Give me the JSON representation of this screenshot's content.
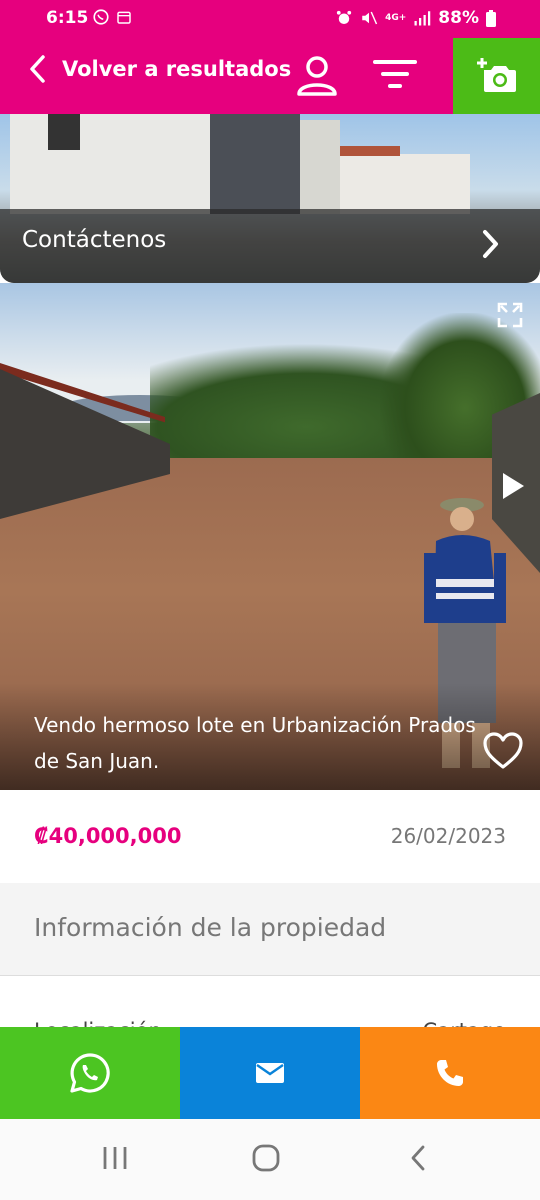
{
  "status_bar": {
    "time": "6:15",
    "battery": "88%",
    "network": "4G+"
  },
  "header": {
    "back_label": "Volver a resultados",
    "colors": {
      "primary": "#e6007e",
      "camera_bg": "#4cbb17"
    },
    "icons": [
      "chevron-left-icon",
      "user-icon",
      "filter-icon",
      "add-photo-icon"
    ]
  },
  "contact_banner": {
    "label": "Contáctenos"
  },
  "listing": {
    "caption": "Vendo hermoso lote en Urbanización Prados de San Juan.",
    "price": "₡40,000,000",
    "date": "26/02/2023",
    "icons": [
      "expand-icon",
      "play-icon",
      "heart-icon"
    ]
  },
  "info": {
    "section_title": "Información de la propiedad",
    "rows": [
      {
        "key": "Localización",
        "value": "Cartago"
      }
    ]
  },
  "actions": {
    "items": [
      {
        "name": "whatsapp",
        "icon": "whatsapp-icon",
        "color": "#4cc522"
      },
      {
        "name": "email",
        "icon": "mail-icon",
        "color": "#0a83d9"
      },
      {
        "name": "call",
        "icon": "phone-icon",
        "color": "#fb8714"
      }
    ]
  },
  "system_nav": {
    "icons": [
      "recent-apps-icon",
      "home-icon",
      "back-icon"
    ]
  }
}
